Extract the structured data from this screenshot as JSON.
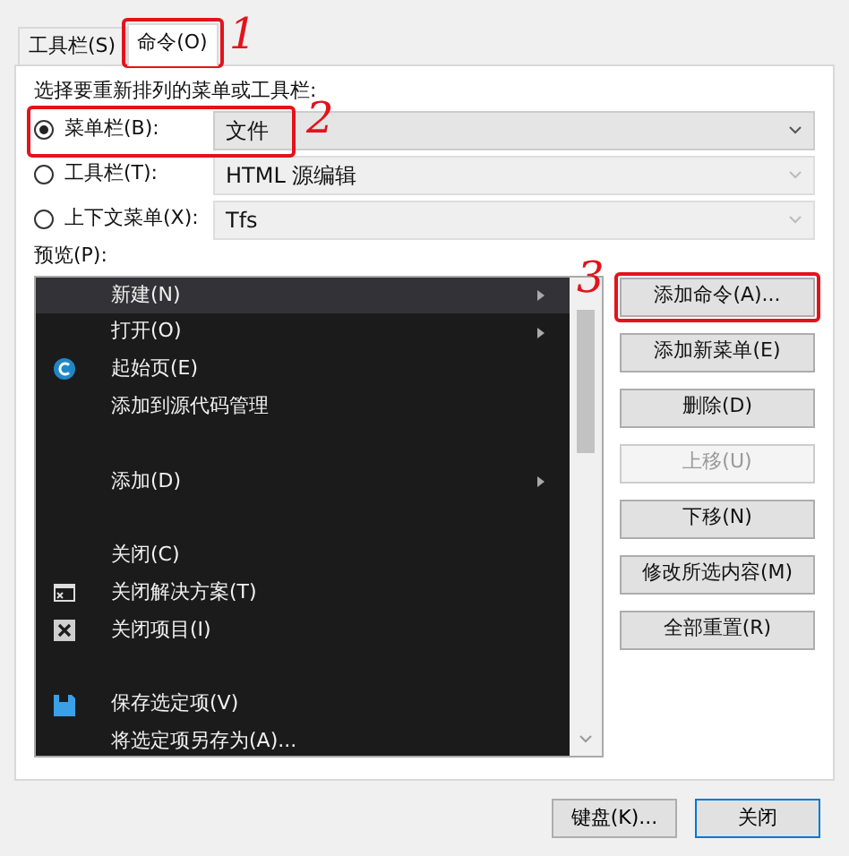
{
  "tabs": [
    {
      "label": "工具栏(S)",
      "selected": false
    },
    {
      "label": "命令(O)",
      "selected": true
    }
  ],
  "prompt": "选择要重新排列的菜单或工具栏:",
  "targets": [
    {
      "label": "菜单栏(B):",
      "selected": true,
      "value": "文件",
      "disabled": false
    },
    {
      "label": "工具栏(T):",
      "selected": false,
      "value": "HTML 源编辑",
      "disabled": true
    },
    {
      "label": "上下文菜单(X):",
      "selected": false,
      "value": "Tfs",
      "disabled": true
    }
  ],
  "preview": {
    "label": "预览(P):",
    "items": [
      {
        "kind": "item",
        "label": "新建(N)",
        "submenu": true,
        "selected": true
      },
      {
        "kind": "item",
        "label": "打开(O)",
        "submenu": true,
        "selected": false
      },
      {
        "kind": "item",
        "label": "起始页(E)",
        "selected": false
      },
      {
        "kind": "item",
        "label": "添加到源代码管理",
        "selected": false
      },
      {
        "kind": "separator"
      },
      {
        "kind": "item",
        "label": "添加(D)",
        "submenu": true,
        "selected": false
      },
      {
        "kind": "separator"
      },
      {
        "kind": "item",
        "label": "关闭(C)",
        "selected": false
      },
      {
        "kind": "item",
        "label": "关闭解决方案(T)",
        "selected": false
      },
      {
        "kind": "item",
        "label": "关闭项目(I)",
        "selected": false
      },
      {
        "kind": "separator"
      },
      {
        "kind": "item",
        "label": "保存选定项(V)",
        "selected": false
      },
      {
        "kind": "item",
        "label": "将选定项另存为(A)...",
        "selected": false
      }
    ]
  },
  "actions": [
    {
      "label": "添加命令(A)...",
      "disabled": false
    },
    {
      "label": "添加新菜单(E)",
      "disabled": false
    },
    {
      "label": "删除(D)",
      "disabled": false
    },
    {
      "label": "上移(U)",
      "disabled": true
    },
    {
      "label": "下移(N)",
      "disabled": false
    },
    {
      "label": "修改所选内容(M)",
      "disabled": false
    },
    {
      "label": "全部重置(R)",
      "disabled": false
    }
  ],
  "footer_buttons": [
    {
      "label": "键盘(K)...",
      "focused": false
    },
    {
      "label": "关闭",
      "focused": true
    }
  ],
  "annotations": [
    {
      "label": "1"
    },
    {
      "label": "2"
    },
    {
      "label": "3"
    }
  ]
}
